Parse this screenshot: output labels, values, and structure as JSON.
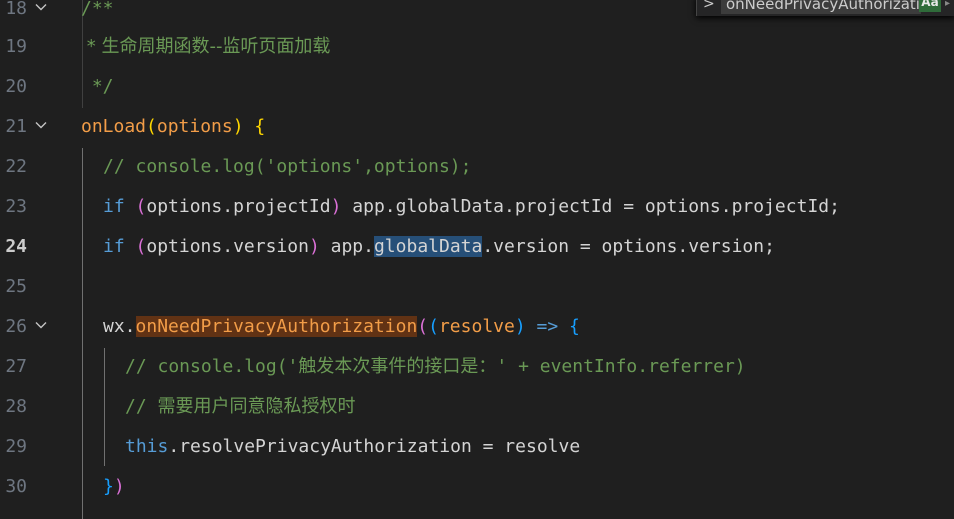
{
  "editor": {
    "language": "javascript",
    "lines": [
      {
        "number": "18",
        "text": "/**"
      },
      {
        "number": "19",
        "text": " * 生命周期函数--监听页面加载"
      },
      {
        "number": "20",
        "text": " */"
      },
      {
        "number": "21",
        "text": "onLoad(options) {"
      },
      {
        "number": "22",
        "text": "  // console.log('options',options);"
      },
      {
        "number": "23",
        "text": "  if (options.projectId) app.globalData.projectId = options.projectId;"
      },
      {
        "number": "24",
        "text": "  if (options.version) app.globalData.version = options.version;"
      },
      {
        "number": "25",
        "text": ""
      },
      {
        "number": "26",
        "text": "  wx.onNeedPrivacyAuthorization((resolve) => {"
      },
      {
        "number": "27",
        "text": "    // console.log('触发本次事件的接口是：' + eventInfo.referrer)"
      },
      {
        "number": "28",
        "text": "    // 需要用户同意隐私授权时"
      },
      {
        "number": "29",
        "text": "    this.resolvePrivacyAuthorization = resolve"
      },
      {
        "number": "30",
        "text": "  })"
      }
    ],
    "active_line": "24",
    "highlighted_word": "globalData",
    "search_match": "onNeedPrivacyAuthorization"
  },
  "find_widget": {
    "toggle_glyph": ">",
    "search_value": "onNeedPrivacyAuthorization",
    "match_case_label": "Aa",
    "match_case_active": true
  },
  "colors": {
    "background": "#1f1f1f",
    "comment": "#6a9955",
    "keyword": "#569cd6",
    "function": "#f29d48",
    "line_number": "#6e7681",
    "word_highlight": "#264f78",
    "find_highlight": "#613214"
  }
}
